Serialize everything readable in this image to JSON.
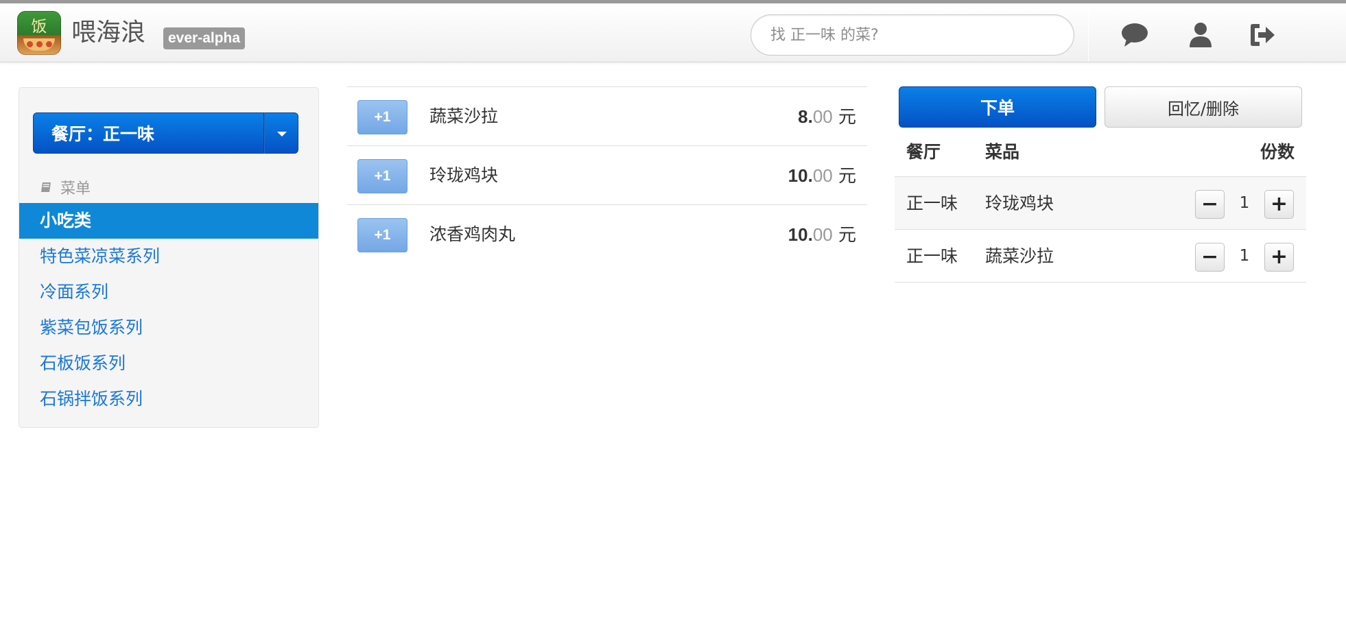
{
  "header": {
    "brand": "喂海浪",
    "logo_char": "饭",
    "badge": "ever-alpha",
    "search_placeholder": "找 正一味 的菜?",
    "icons": [
      "chat-icon",
      "user-icon",
      "logout-icon"
    ]
  },
  "sidebar": {
    "restaurant_button": "餐厅：正一味",
    "menu_header": "菜单",
    "items": [
      {
        "label": "小吃类",
        "active": true
      },
      {
        "label": "特色菜凉菜系列",
        "active": false
      },
      {
        "label": "冷面系列",
        "active": false
      },
      {
        "label": "紫菜包饭系列",
        "active": false
      },
      {
        "label": "石板饭系列",
        "active": false
      },
      {
        "label": "石锅拌饭系列",
        "active": false
      }
    ]
  },
  "dishes": [
    {
      "add_label": "+1",
      "name": "蔬菜沙拉",
      "price_int": "8.",
      "price_dec": "00",
      "unit": " 元"
    },
    {
      "add_label": "+1",
      "name": "玲珑鸡块",
      "price_int": "10.",
      "price_dec": "00",
      "unit": " 元"
    },
    {
      "add_label": "+1",
      "name": "浓香鸡肉丸",
      "price_int": "10.",
      "price_dec": "00",
      "unit": " 元"
    }
  ],
  "order": {
    "submit_label": "下单",
    "recall_label": "回忆/删除",
    "headers": {
      "restaurant": "餐厅",
      "dish": "菜品",
      "qty": "份数"
    },
    "rows": [
      {
        "restaurant": "正一味",
        "dish": "玲珑鸡块",
        "qty": "1",
        "minus": "−",
        "plus": "+"
      },
      {
        "restaurant": "正一味",
        "dish": "蔬菜沙拉",
        "qty": "1",
        "minus": "−",
        "plus": "+"
      }
    ]
  },
  "colors": {
    "primary": "#0a6fe0",
    "active_nav": "#0f88d8",
    "link": "#1a77d6",
    "add_button": "#84b3ec"
  }
}
